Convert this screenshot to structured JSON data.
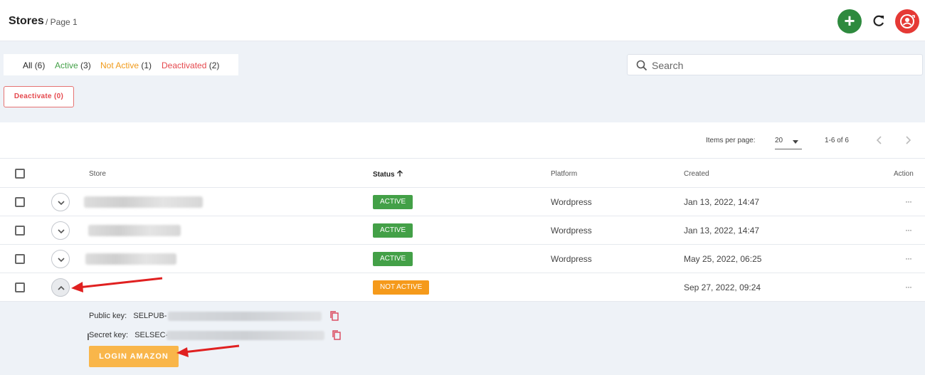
{
  "header": {
    "title": "Stores",
    "subtitle": "/ Page 1",
    "add_icon": "plus-icon",
    "refresh_icon": "refresh-icon",
    "user_icon": "user-switch-icon"
  },
  "filters": {
    "tabs": [
      {
        "label": "All",
        "count": "(6)"
      },
      {
        "label": "Active",
        "count": "(3)"
      },
      {
        "label": "Not Active",
        "count": "(1)"
      },
      {
        "label": "Deactivated",
        "count": "(2)"
      }
    ],
    "deactivate_label": "Deactivate (0)"
  },
  "search": {
    "placeholder": "Search"
  },
  "pagination": {
    "items_per_page_label": "Items per page:",
    "items_per_page": "20",
    "range": "1-6 of 6"
  },
  "table": {
    "columns": {
      "store": "Store",
      "status": "Status",
      "platform": "Platform",
      "created": "Created",
      "action": "Action"
    },
    "rows": [
      {
        "status": "ACTIVE",
        "platform": "Wordpress",
        "created": "Jan 13, 2022, 14:47",
        "action": "···"
      },
      {
        "status": "ACTIVE",
        "platform": "Wordpress",
        "created": "Jan 13, 2022, 14:47",
        "action": "···"
      },
      {
        "status": "ACTIVE",
        "platform": "Wordpress",
        "created": "May 25, 2022, 06:25",
        "action": "···"
      },
      {
        "status": "NOT ACTIVE",
        "platform": "",
        "created": "Sep 27, 2022, 09:24",
        "action": "···"
      }
    ]
  },
  "details": {
    "public_key_label": "Public key:",
    "public_key_prefix": "SELPUB-",
    "secret_key_label": "Secret key:",
    "secret_key_prefix": "SELSEC-",
    "login_button": "LOGIN AMAZON"
  },
  "colors": {
    "active": "#43a047",
    "not_active": "#f59a1b",
    "deactivated": "#e5484d",
    "add_button": "#2e8a3e",
    "user_button": "#e53935",
    "login_button": "#f9b64a",
    "annotation_arrow": "#e02020"
  }
}
